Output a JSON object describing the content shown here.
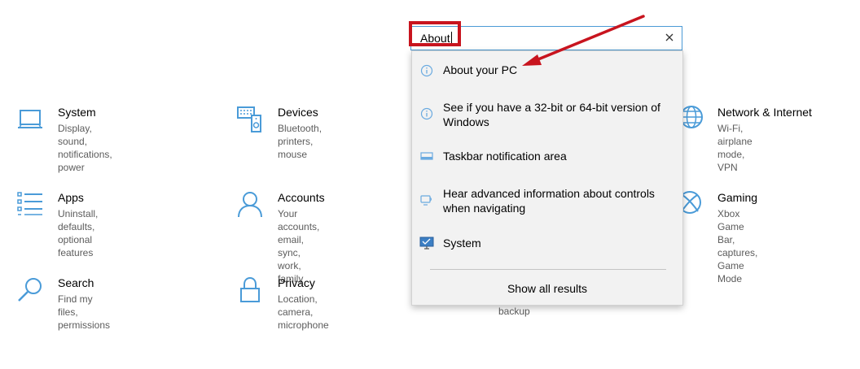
{
  "search": {
    "value": "About",
    "clear_icon": "close-icon"
  },
  "tiles": [
    {
      "title": "System",
      "desc": [
        "Display, sound, notifications,",
        "power"
      ],
      "icon": "laptop-icon"
    },
    {
      "title": "Devices",
      "desc": [
        "Bluetooth, printers, mouse"
      ],
      "icon": "keyboard-speaker-icon"
    },
    {
      "title": "Network & Internet",
      "desc": [
        "Wi-Fi, airplane mode, VPN"
      ],
      "icon": "globe-icon"
    },
    {
      "title": "Apps",
      "desc": [
        "Uninstall, defaults, optional",
        "features"
      ],
      "icon": "apps-list-icon"
    },
    {
      "title": "Accounts",
      "desc": [
        "Your accounts, email, sync,",
        "work, family"
      ],
      "icon": "person-icon"
    },
    {
      "title": "Gaming",
      "desc": [
        "Xbox Game Bar, captures, Game",
        "Mode"
      ],
      "icon": "xbox-icon"
    },
    {
      "title": "Search",
      "desc": [
        "Find my files, permissions"
      ],
      "icon": "search-icon"
    },
    {
      "title": "Privacy",
      "desc": [
        "Location, camera, microphone"
      ],
      "icon": "lock-icon"
    }
  ],
  "results": [
    {
      "lines": [
        "About your PC"
      ],
      "icon": "info-icon"
    },
    {
      "lines": [
        "See if you have a 32-bit or 64-bit version of",
        "Windows"
      ],
      "icon": "info-icon"
    },
    {
      "lines": [
        "Taskbar notification area"
      ],
      "icon": "taskbar-icon"
    },
    {
      "lines": [
        "Hear advanced information about controls",
        "when navigating"
      ],
      "icon": "narrator-icon"
    },
    {
      "lines": [
        "System"
      ],
      "icon": "monitor-icon"
    }
  ],
  "show_all": "Show all results",
  "partial_tile_text": "backup",
  "colors": {
    "accent": "#0078d7",
    "annotation": "#c8141e",
    "icon": "#0078d7"
  }
}
